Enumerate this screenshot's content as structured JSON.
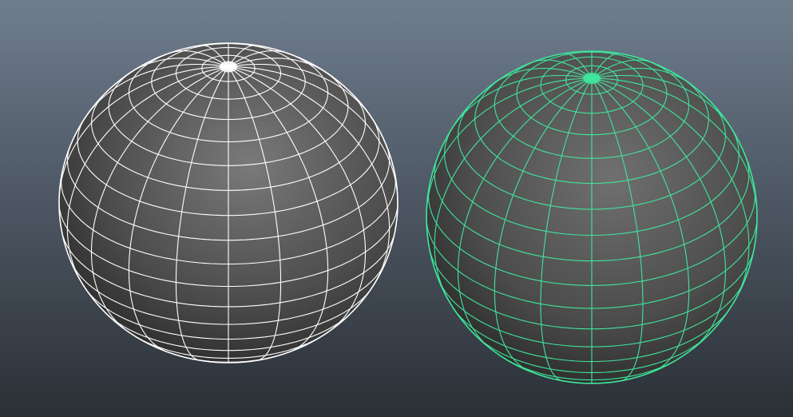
{
  "viewport": {
    "background_top": "#6f7d8d",
    "background_bottom": "#2b3036"
  },
  "objects": [
    {
      "id": "sphere-left",
      "state": "unselected",
      "wire_color": "#ffffff",
      "shade_dark": "#242424",
      "shade_light": "#7a7a7a",
      "pole_tilt": 0.55
    },
    {
      "id": "sphere-right",
      "state": "selected",
      "wire_color": "#3fe59d",
      "shade_dark": "#222222",
      "shade_light": "#707070",
      "pole_tilt": 0.58
    }
  ]
}
